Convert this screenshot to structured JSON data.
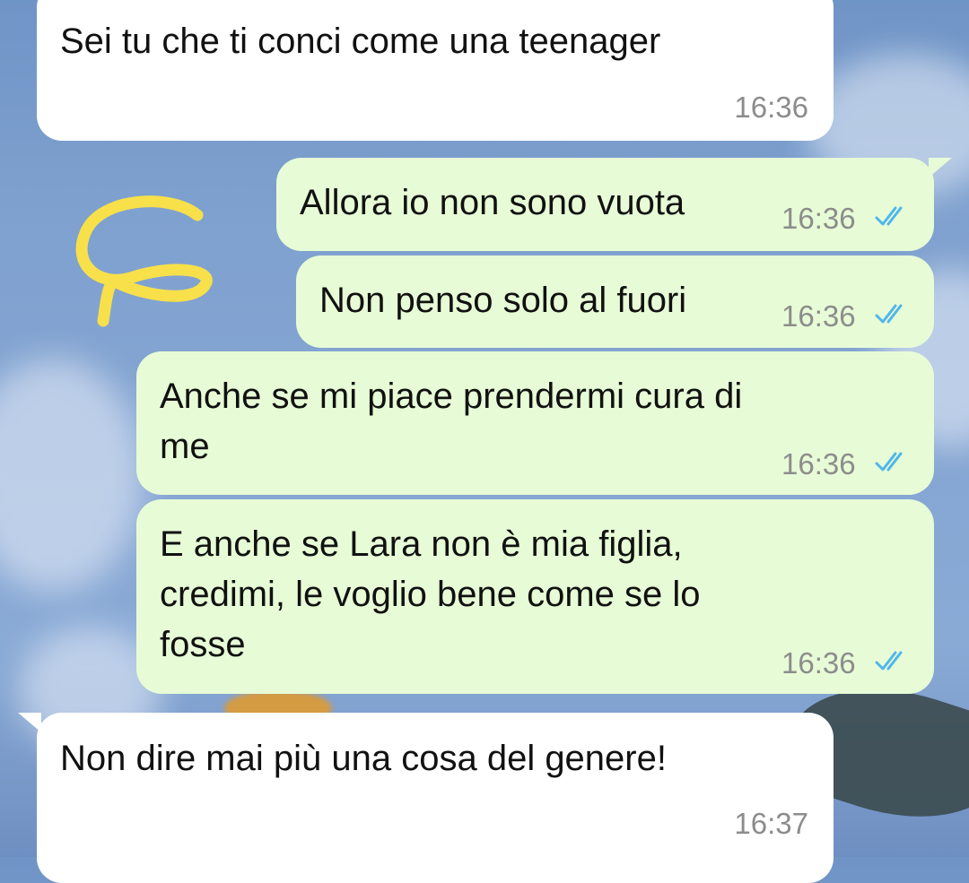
{
  "messages": [
    {
      "direction": "incoming",
      "text": "Sei tu che ti conci come una teenager",
      "time": "16:36"
    },
    {
      "direction": "outgoing",
      "text": "Allora io non sono vuota",
      "time": "16:36",
      "status": "read"
    },
    {
      "direction": "outgoing",
      "text": "Non penso solo al fuori",
      "time": "16:36",
      "status": "read"
    },
    {
      "direction": "outgoing",
      "text": "Anche se mi piace prendermi cura di\nme",
      "time": "16:36",
      "status": "read"
    },
    {
      "direction": "outgoing",
      "text": "E anche se Lara non è mia figlia,\ncredimi, le voglio bene come se lo\nfosse",
      "time": "16:36",
      "status": "read"
    },
    {
      "direction": "incoming",
      "text": "Non dire mai più una cosa del genere!",
      "time": "16:37"
    }
  ],
  "colors": {
    "incoming_bubble": "#ffffff",
    "outgoing_bubble": "#e7fcd6",
    "read_tick": "#4fb6ec",
    "timestamp": "#8c8c8c",
    "doodle": "#f7e04a"
  },
  "icons": {
    "read_receipt": "double-check-icon",
    "doodle": "hand-drawn-doodle"
  }
}
